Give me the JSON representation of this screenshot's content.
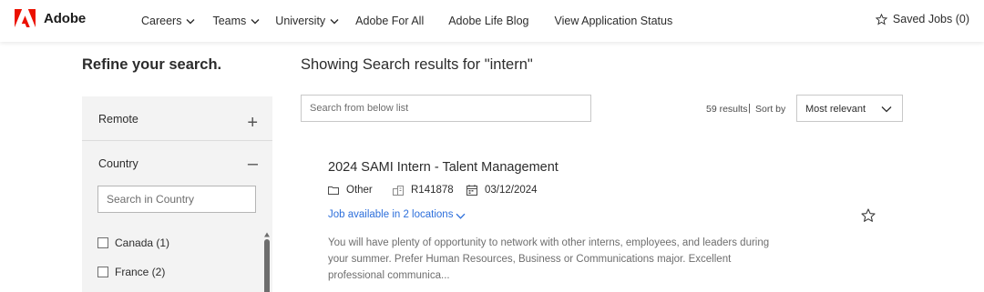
{
  "header": {
    "brand": "Adobe",
    "brand_color": "#eb1000",
    "nav": [
      {
        "label": "Careers",
        "has_dropdown": true
      },
      {
        "label": "Teams",
        "has_dropdown": true
      },
      {
        "label": "University",
        "has_dropdown": true
      },
      {
        "label": "Adobe For All",
        "has_dropdown": false
      },
      {
        "label": "Adobe Life Blog",
        "has_dropdown": false
      },
      {
        "label": "View Application Status",
        "has_dropdown": false
      }
    ],
    "saved_jobs": "Saved Jobs (0)"
  },
  "sidebar": {
    "title": "Refine your search.",
    "filters": {
      "remote": {
        "label": "Remote",
        "toggle": "+"
      },
      "country": {
        "label": "Country",
        "toggle": "–",
        "search_placeholder": "Search in Country",
        "options": [
          {
            "label": "Canada (1)",
            "checked": false
          },
          {
            "label": "France (2)",
            "checked": false
          }
        ]
      }
    }
  },
  "results": {
    "title": "Showing Search results for \"intern\"",
    "search_placeholder": "Search from below list",
    "count": "59 results",
    "separator": "|",
    "sort_label": "Sort by",
    "sort_value": "Most relevant"
  },
  "jobs": [
    {
      "title": "2024 SAMI Intern - Talent Management",
      "category": "Other",
      "req_id": "R141878",
      "date": "03/12/2024",
      "locations": "Job available in 2 locations",
      "description": "You will have plenty of opportunity to network with other interns, employees, and leaders during your summer. Prefer Human Resources, Business or Communications major. Excellent professional communica...",
      "link_color": "#2d6fdb"
    }
  ]
}
